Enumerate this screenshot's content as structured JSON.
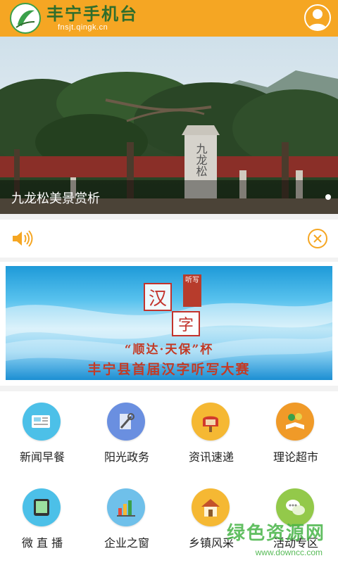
{
  "header": {
    "app_title": "丰宁手机台",
    "domain": "fnsjt.qingk.cn",
    "brand_color": "#f5a623",
    "profile_icon": "user-icon"
  },
  "banner": {
    "caption": "九龙松美景赏析",
    "stele_text": "九龙松",
    "page_indicator_current": 1
  },
  "notice": {
    "speaker_icon": "speaker-icon",
    "close_icon": "close-circle-icon",
    "accent_color": "#f5a623"
  },
  "promo": {
    "char1": "汉",
    "char2": "字",
    "seal_text": "听写",
    "line1": "“顺达·天保”杯",
    "line2": "丰宁县首届汉字听写大赛"
  },
  "grid": {
    "items": [
      {
        "label": "新闻早餐",
        "icon": "newspaper-icon",
        "color": "#4cc0e8"
      },
      {
        "label": "阳光政务",
        "icon": "tools-icon",
        "color": "#6a8fe0"
      },
      {
        "label": "资讯速递",
        "icon": "mailbox-icon",
        "color": "#f5b833"
      },
      {
        "label": "理论超市",
        "icon": "book-icon",
        "color": "#f09a28"
      },
      {
        "label": "微 直 播",
        "icon": "tablet-icon",
        "color": "#4cc0e8"
      },
      {
        "label": "企业之窗",
        "icon": "bar-chart-icon",
        "color": "#6fc0ea"
      },
      {
        "label": "乡镇风采",
        "icon": "house-icon",
        "color": "#f5b833"
      },
      {
        "label": "活动专区",
        "icon": "chat-bubbles-icon",
        "color": "#93c94a"
      }
    ]
  },
  "watermark": {
    "text": "绿色资源网",
    "url": "www.downcc.com"
  }
}
